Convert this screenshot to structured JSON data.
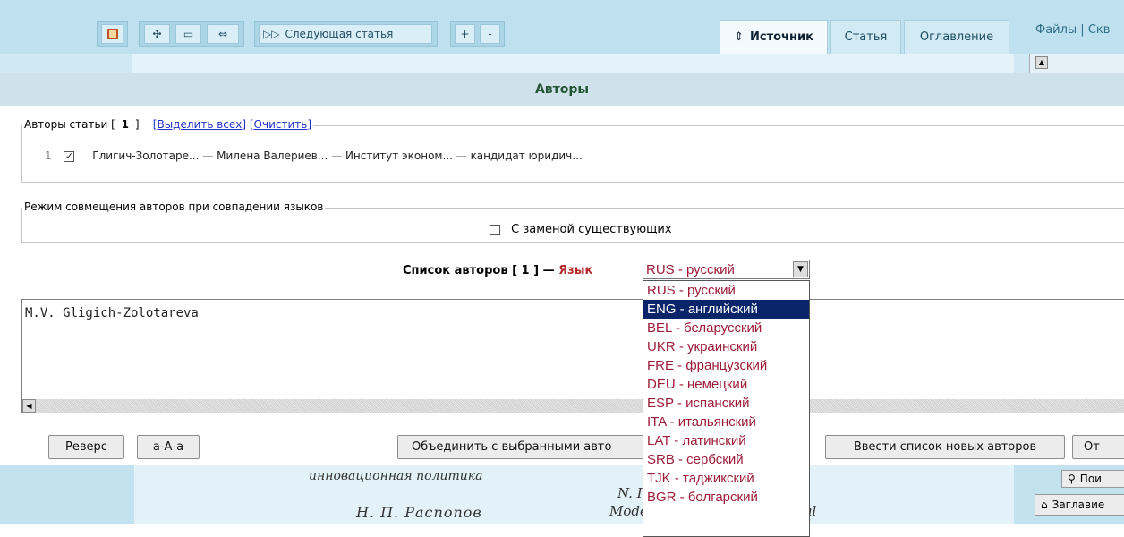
{
  "toolbar": {
    "next_article": "Следующая статья",
    "plus": "+",
    "minus": "-"
  },
  "tabs": [
    {
      "label": "Источник",
      "icon": "sort-icon",
      "active": true
    },
    {
      "label": "Статья",
      "active": false
    },
    {
      "label": "Оглавление",
      "active": false
    }
  ],
  "top_links": "Файлы | Скв",
  "section_title": "Авторы",
  "authors_fieldset": {
    "legend_prefix": "Авторы статьи [",
    "count": "1",
    "legend_suffix": "]",
    "select_all": "[Выделить всех]",
    "clear": "[Очистить]",
    "rows": [
      {
        "num": "1",
        "checked": true,
        "surname": "Глигич-Золотаре...",
        "name": "Милена Валериев...",
        "org": "Институт эконом...",
        "degree": "кандидат юридич..."
      }
    ],
    "sep": "—"
  },
  "merge_fieldset": {
    "legend": "Режим совмещения авторов при совпадении языков",
    "replace_label": "С заменой существующих"
  },
  "author_list": {
    "title_prefix": "Список авторов [",
    "count": "1",
    "title_suffix": "] —",
    "lang_label": "Язык",
    "selected_lang": "RUS - русский",
    "text": "M.V. Gligich-Zolotareva"
  },
  "languages": [
    "RUS - русский",
    "ENG - английский",
    "BEL - беларусский",
    "UKR - украинский",
    "FRE - французский",
    "DEU - немецкий",
    "ESP - испанский",
    "ITA - итальянский",
    "LAT - латинский",
    "SRB - сербский",
    "TJK - таджикский",
    "BGR - болгарский"
  ],
  "highlighted_language": "ENG - английский",
  "buttons": {
    "reverse": "Реверс",
    "case": "а-А-а",
    "merge": "Объединить с выбранными авто",
    "enter_new": "Ввести список новых авторов",
    "other": "От"
  },
  "preview": {
    "line1": "инновационная политика",
    "line2": "N. I",
    "line3": "Н. П.  Распопов",
    "line4": "Modernization of the Regional",
    "side_search": "Пои",
    "side_title": "Заглавие"
  }
}
